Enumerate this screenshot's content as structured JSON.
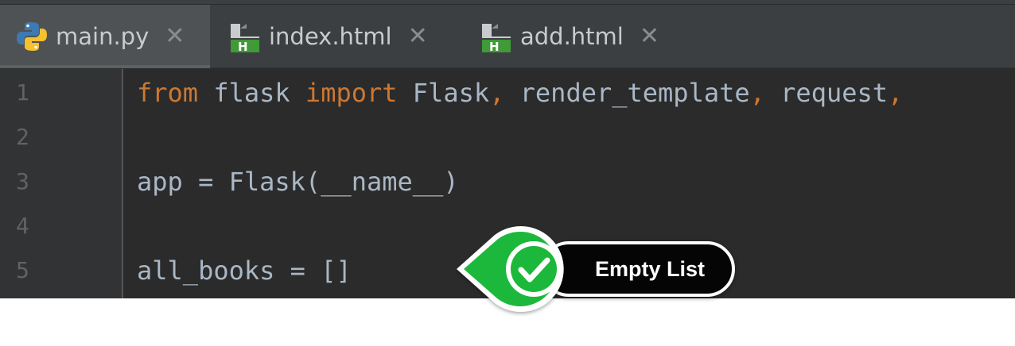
{
  "tabs": [
    {
      "label": "main.py",
      "icon": "python-file-icon",
      "active": true
    },
    {
      "label": "index.html",
      "icon": "html-file-icon",
      "active": false
    },
    {
      "label": "add.html",
      "icon": "html-file-icon",
      "active": false
    }
  ],
  "tab_close_glyph": "✕",
  "html_icon_letter": "H",
  "line_numbers": [
    "1",
    "2",
    "3",
    "4",
    "5"
  ],
  "code": {
    "line1": {
      "kw_from": "from",
      "module": " flask ",
      "kw_import": "import",
      "name1": " Flask",
      "comma1": ",",
      "name2": " render_template",
      "comma2": ",",
      "name3": " request",
      "comma3": ","
    },
    "line3": "app = Flask(__name__)",
    "line5": "all_books = []"
  },
  "callout": {
    "label": "Empty List",
    "icon": "check-icon"
  },
  "colors": {
    "editor_bg": "#2b2b2b",
    "keyword": "#cc7832",
    "text": "#a9b7c6",
    "line_number": "#606366",
    "callout_green": "#1fb83a",
    "html_icon_green": "#3f9a37"
  }
}
